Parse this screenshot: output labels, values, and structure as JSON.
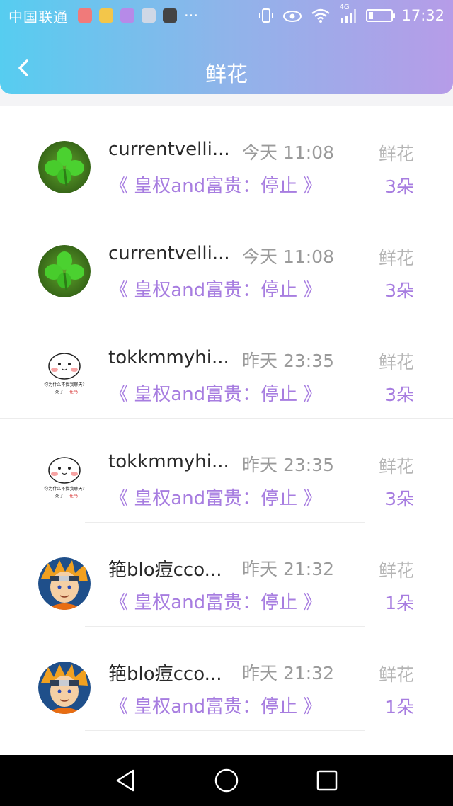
{
  "statusbar": {
    "carrier": "中国联通",
    "more": "···",
    "network": "4G",
    "time": "17:32"
  },
  "header": {
    "title": "鲜花"
  },
  "items": [
    {
      "name": "currentvelli...",
      "time": "今天 11:08",
      "book": "《 皇权and富贵：停止 》",
      "gift_type": "鲜花",
      "gift_count": "3朵",
      "avatar": "clover"
    },
    {
      "name": "currentvelli...",
      "time": "今天 11:08",
      "book": "《 皇权and富贵：停止 》",
      "gift_type": "鲜花",
      "gift_count": "3朵",
      "avatar": "clover"
    },
    {
      "name": "tokkmmyhi...",
      "time": "昨天 23:35",
      "book": "《 皇权and富贵：停止 》",
      "gift_type": "鲜花",
      "gift_count": "3朵",
      "avatar": "cartoon"
    },
    {
      "name": "tokkmmyhi...",
      "time": "昨天 23:35",
      "book": "《 皇权and富贵：停止 》",
      "gift_type": "鲜花",
      "gift_count": "3朵",
      "avatar": "cartoon"
    },
    {
      "name": "筢blo痘cco...",
      "time": "昨天 21:32",
      "book": "《 皇权and富贵：停止 》",
      "gift_type": "鲜花",
      "gift_count": "1朵",
      "avatar": "ninja"
    },
    {
      "name": "筢blo痘cco...",
      "time": "昨天 21:32",
      "book": "《 皇权and富贵：停止 》",
      "gift_type": "鲜花",
      "gift_count": "1朵",
      "avatar": "ninja"
    }
  ],
  "colors": {
    "accent": "#a77de0",
    "gradient_start": "#56cdf0",
    "gradient_end": "#b69ce8"
  },
  "sticker_text": {
    "line1": "你为什么不找我聊天?",
    "line2": "死了",
    "line3": "在吗"
  }
}
